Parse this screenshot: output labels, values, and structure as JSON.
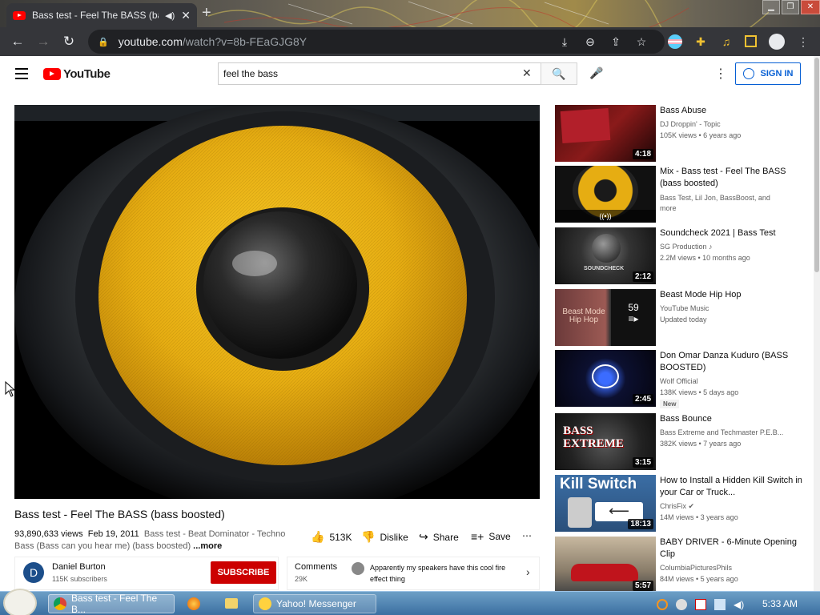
{
  "browser": {
    "tab_title": "Bass test - Feel The BASS (bas",
    "new_tab": "+",
    "url_host": "youtube.com",
    "url_path": "/watch?v=8b-FEaGJG8Y"
  },
  "youtube": {
    "logo_text": "YouTube",
    "search_query": "feel the bass",
    "sign_in": "SIGN IN"
  },
  "video": {
    "title": "Bass test - Feel The BASS (bass boosted)",
    "views": "93,890,633 views",
    "date": "Feb 19, 2011",
    "description": "Bass test - Beat Dominator - Techno Bass (Bass can you hear me) (bass boosted)",
    "more": "...more",
    "likes": "513K",
    "dislike": "Dislike",
    "share": "Share",
    "save": "Save"
  },
  "channel": {
    "avatar_letter": "D",
    "name": "Daniel Burton",
    "subscribers": "115K subscribers",
    "subscribe": "SUBSCRIBE"
  },
  "comments": {
    "label": "Comments",
    "count": "29K",
    "top_comment": "Apparently my speakers have this cool fire effect thing"
  },
  "recommendations": [
    {
      "title": "Bass Abuse",
      "channel": "DJ Droppin' - Topic",
      "stats": "105K views • 6 years ago",
      "duration": "4:18"
    },
    {
      "title": "Mix - Bass test - Feel The BASS (bass boosted)",
      "channel": "Bass Test, Lil Jon, BassBoost, and more",
      "stats": "",
      "duration": ""
    },
    {
      "title": "Soundcheck 2021 | Bass Test",
      "channel": "SG Production ♪",
      "stats": "2.2M views • 10 months ago",
      "duration": "2:12"
    },
    {
      "title": "Beast Mode Hip Hop",
      "channel": "YouTube Music",
      "stats": "Updated today",
      "duration": "",
      "playlist_count": "59"
    },
    {
      "title": "Don Omar Danza Kuduro (BASS BOOSTED)",
      "channel": "Wolf Official",
      "stats": "138K views • 5 days ago",
      "duration": "2:45",
      "badge": "New"
    },
    {
      "title": "Bass Bounce",
      "channel": "Bass Extreme and Techmaster P.E.B...",
      "stats": "382K views • 7 years ago",
      "duration": "3:15"
    },
    {
      "title": "How to Install a Hidden Kill Switch in your Car or Truck...",
      "channel": "ChrisFix",
      "stats": "14M views • 3 years ago",
      "duration": "18:13"
    },
    {
      "title": "BABY DRIVER - 6-Minute Opening Clip",
      "channel": "ColumbiaPicturesPhils",
      "stats": "84M views • 5 years ago",
      "duration": "5:57"
    }
  ],
  "thumb_text": {
    "soundcheck": "SOUNDCHECK",
    "beast_mode": "Beast Mode Hip Hop",
    "bass_extreme": "BASS EXTREME",
    "kill_switch": "Kill Switch"
  },
  "taskbar": {
    "chrome_window": "Bass test - Feel The B...",
    "messenger_window": "Yahoo! Messenger",
    "clock": "5:33 AM"
  },
  "colors": {
    "youtube_red": "#ff0000",
    "subscribe_red": "#cc0000",
    "link_blue": "#065fd4",
    "speaker_yellow": "#e8b21a"
  }
}
